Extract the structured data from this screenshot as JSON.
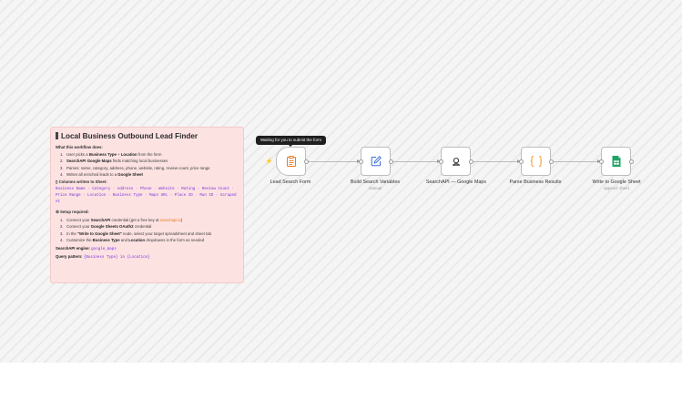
{
  "note": {
    "title": "Local Business Outbound Lead Finder",
    "what_heading": "What this workflow does:",
    "what_items": [
      {
        "num": "1.",
        "pre": "User picks a ",
        "b1": "Business Type",
        "mid": " + ",
        "b2": "Location",
        "post": " from the form"
      },
      {
        "num": "2.",
        "pre": "",
        "b1": "SearchAPI Google Maps",
        "mid": " finds matching local businesses",
        "b2": "",
        "post": ""
      },
      {
        "num": "3.",
        "pre": "Parses: name, category, address, phone, website, rating, review count, price range",
        "b1": "",
        "mid": "",
        "b2": "",
        "post": ""
      },
      {
        "num": "4.",
        "pre": "Writes all enriched leads to a ",
        "b1": "Google Sheet",
        "mid": "",
        "b2": "",
        "post": ""
      }
    ],
    "columns_heading": "Columns written to Sheet:",
    "columns_text": "Business Name · Category · Address · Phone · Website · Rating · Review Count · Price Range · Location · Business Type · Maps URL · Place ID · Run ID · Scraped At",
    "setup_heading": "⚙ Setup required:",
    "setup_items": [
      {
        "num": "1.",
        "pre": "Connect your ",
        "b1": "SearchAPI",
        "mid": " credential (get a free key at ",
        "link": "searchapi.io",
        "post": ")"
      },
      {
        "num": "2.",
        "pre": "Connect your ",
        "b1": "Google Sheets OAuth2",
        "mid": " credential",
        "link": "",
        "post": ""
      },
      {
        "num": "3.",
        "pre": "In the ",
        "b1": "\"Write to Google Sheet\"",
        "mid": " node, select your target spreadsheet and sheet tab",
        "link": "",
        "post": ""
      },
      {
        "num": "4.",
        "pre": "Customize the ",
        "b1": "Business Type",
        "mid": " and ",
        "link": "",
        "post": "",
        "b2": "Location",
        "end": " dropdowns in the form as needed"
      }
    ],
    "engine_label": "SearchAPI engine:",
    "engine_value": "google_maps",
    "query_label": "Query pattern:",
    "query_value": "{Business Type} in {Location}"
  },
  "tooltip": "Waiting for you to submit the form",
  "nodes": [
    {
      "label": "Lead Search Form",
      "sub": "",
      "icon": "form-icon"
    },
    {
      "label": "Build Search Variables",
      "sub": "manual",
      "icon": "edit-icon"
    },
    {
      "label": "SearchAPI — Google Maps",
      "sub": "",
      "icon": "searchapi-icon"
    },
    {
      "label": "Parse Business Results",
      "sub": "",
      "icon": "code-braces-icon"
    },
    {
      "label": "Write to Google Sheet",
      "sub": "append: sheet",
      "icon": "google-sheets-icon"
    }
  ],
  "colors": {
    "accent_orange": "#e8791d",
    "note_bg": "#fde2e2",
    "code_purple": "#7b32e0",
    "sheets_green": "#21a463"
  }
}
